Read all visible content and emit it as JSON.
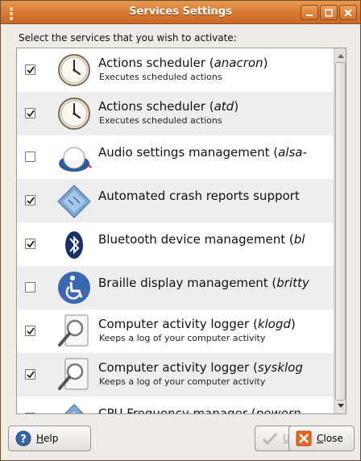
{
  "window": {
    "title": "Services Settings"
  },
  "instruction": "Select the services that you wish to activate:",
  "services": [
    {
      "name_prefix": "Actions scheduler (",
      "name_italic": "anacron",
      "name_suffix": ")",
      "description": "Executes scheduled actions",
      "checked": true,
      "icon": "clock-icon"
    },
    {
      "name_prefix": "Actions scheduler (",
      "name_italic": "atd",
      "name_suffix": ")",
      "description": "Executes scheduled actions",
      "checked": true,
      "icon": "clock-icon"
    },
    {
      "name_prefix": "Audio settings management (",
      "name_italic": "alsa-",
      "name_suffix": "",
      "description": "",
      "checked": false,
      "icon": "volume-knob-icon"
    },
    {
      "name_prefix": "Automated crash reports support",
      "name_italic": "",
      "name_suffix": "",
      "description": "",
      "checked": true,
      "icon": "crash-report-icon"
    },
    {
      "name_prefix": "Bluetooth device management (",
      "name_italic": "bl",
      "name_suffix": "",
      "description": "",
      "checked": true,
      "icon": "bluetooth-icon"
    },
    {
      "name_prefix": "Braille display management (",
      "name_italic": "britty",
      "name_suffix": "",
      "description": "",
      "checked": false,
      "icon": "accessibility-icon"
    },
    {
      "name_prefix": "Computer activity logger (",
      "name_italic": "klogd",
      "name_suffix": ")",
      "description": "Keeps a log of your computer activity",
      "checked": true,
      "icon": "log-viewer-icon"
    },
    {
      "name_prefix": "Computer activity logger (",
      "name_italic": "sysklog",
      "name_suffix": "",
      "description": "Keeps a log of your computer activity",
      "checked": true,
      "icon": "log-viewer-icon"
    },
    {
      "name_prefix": "CPU Frequency manager (",
      "name_italic": "powern",
      "name_suffix": "",
      "description": "",
      "checked": true,
      "icon": "cpu-icon"
    }
  ],
  "buttons": {
    "help_mnemonic": "H",
    "help_rest": "elp",
    "unlock_mnemonic": "U",
    "unlock_rest": "nlock",
    "close_mnemonic": "C",
    "close_rest": "lose"
  },
  "colors": {
    "titlebar": "#d8782f",
    "row_alt": "#eeeeee",
    "close_icon": "#e8661e",
    "help_icon": "#3565a4"
  }
}
